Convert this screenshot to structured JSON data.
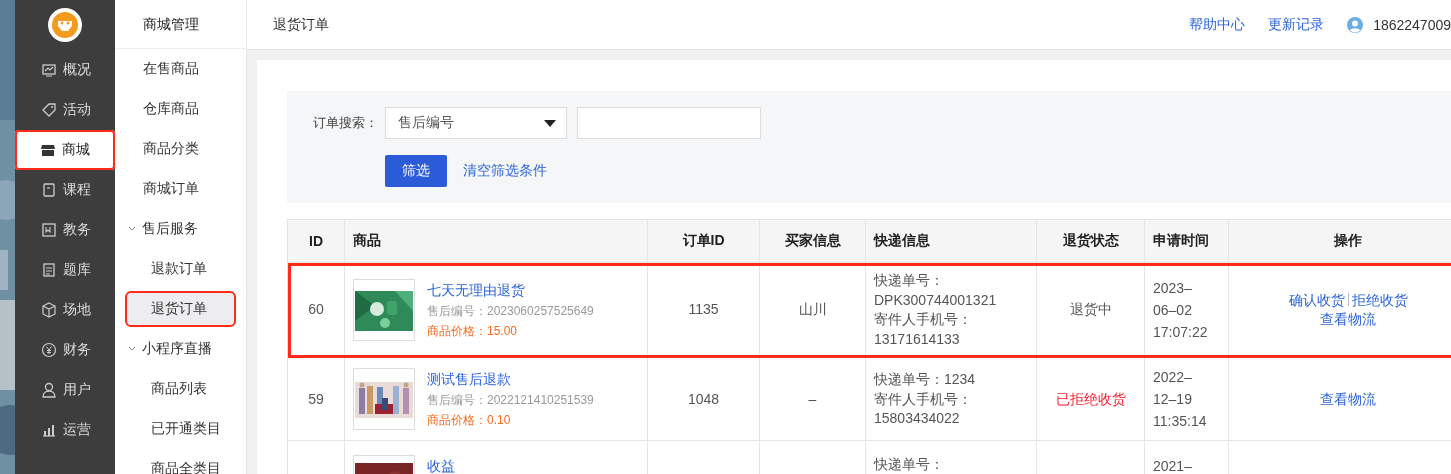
{
  "nav": {
    "items": [
      {
        "label": "概况",
        "selected": false,
        "annotated": false
      },
      {
        "label": "活动",
        "selected": false,
        "annotated": false
      },
      {
        "label": "商城",
        "selected": true,
        "annotated": true
      },
      {
        "label": "课程",
        "selected": false,
        "annotated": false
      },
      {
        "label": "教务",
        "selected": false,
        "annotated": false
      },
      {
        "label": "题库",
        "selected": false,
        "annotated": false
      },
      {
        "label": "场地",
        "selected": false,
        "annotated": false
      },
      {
        "label": "财务",
        "selected": false,
        "annotated": false
      },
      {
        "label": "用户",
        "selected": false,
        "annotated": false
      },
      {
        "label": "运营",
        "selected": false,
        "annotated": false
      }
    ]
  },
  "submenu": {
    "title": "商城管理",
    "items": [
      {
        "label": "在售商品",
        "selected": false,
        "annotated": false
      },
      {
        "label": "仓库商品",
        "selected": false,
        "annotated": false
      },
      {
        "label": "商品分类",
        "selected": false,
        "annotated": false
      },
      {
        "label": "商城订单",
        "selected": false,
        "annotated": false
      },
      {
        "label": "售后服务",
        "expanded": true,
        "children": [
          {
            "label": "退款订单",
            "selected": false,
            "annotated": false
          },
          {
            "label": "退货订单",
            "selected": true,
            "annotated": true
          }
        ]
      },
      {
        "label": "小程序直播",
        "expanded": true,
        "children": [
          {
            "label": "商品列表",
            "selected": false,
            "annotated": false
          },
          {
            "label": "已开通类目",
            "selected": false,
            "annotated": false
          },
          {
            "label": "商品全类目",
            "selected": false,
            "annotated": false
          }
        ]
      }
    ]
  },
  "header": {
    "title": "退货订单",
    "links": [
      "帮助中心",
      "更新记录"
    ],
    "user": "1862247009"
  },
  "filter": {
    "label": "订单搜索：",
    "select": "售后编号",
    "button": "筛选",
    "clear_link": "清空筛选条件"
  },
  "table": {
    "columns": [
      "ID",
      "商品",
      "订单ID",
      "买家信息",
      "快递信息",
      "退货状态",
      "申请时间",
      "操作"
    ],
    "rows": [
      {
        "id": "60",
        "title": "七天无理由退货",
        "after_sale_no": "售后编号：2023060257525649",
        "price": "商品价格：15.00",
        "order_id": "1135",
        "buyer": "山川",
        "express": [
          "快递单号：DPK300744001321",
          "寄件人手机号：13171614133"
        ],
        "status": {
          "kind": "pending",
          "text": "退货中"
        },
        "time": [
          "2023–",
          "06–02",
          "17:07:22"
        ],
        "actions": [
          [
            "确认收货",
            "拒绝收货"
          ],
          [
            "查看物流"
          ]
        ],
        "annotated": true
      },
      {
        "id": "59",
        "title": "测试售后退款",
        "after_sale_no": "售后编号：2022121410251539",
        "price": "商品价格：0.10",
        "order_id": "1048",
        "buyer": "–",
        "express": [
          "快递单号：1234",
          "寄件人手机号：15803434022"
        ],
        "status": {
          "kind": "rejected",
          "text": "已拒绝收货"
        },
        "time": [
          "2022–",
          "12–19",
          "11:35:14"
        ],
        "actions": [
          [
            "查看物流"
          ]
        ],
        "annotated": false
      },
      {
        "title": "收益",
        "express": [
          "快递单号："
        ],
        "time": [
          "2021–"
        ],
        "annotated": false
      }
    ]
  }
}
